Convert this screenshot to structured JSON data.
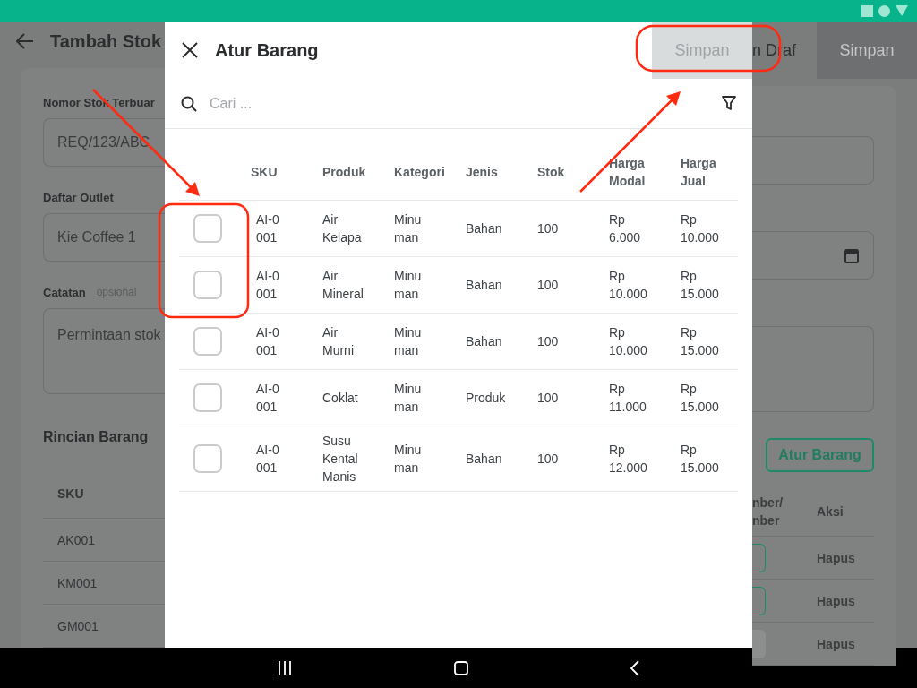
{
  "background_page": {
    "title": "Tambah Stok",
    "draft_button": "n Draf",
    "save_button": "Simpan",
    "fields": [
      {
        "label": "Nomor Stok Terbuar",
        "value": "REQ/123/ABC",
        "kind": "text"
      },
      {
        "label": "Daftar Outlet",
        "value": "Kie Coffee 1",
        "kind": "date"
      },
      {
        "label": "Catatan",
        "hint": "opsional",
        "value": "Permintaan stok",
        "kind": "textarea"
      }
    ],
    "section_title": "Rincian Barang",
    "manage_button": "Atur Barang",
    "table": {
      "columns": [
        "SKU",
        "nber/ nber",
        "Aksi"
      ],
      "rows": [
        {
          "sku": "AK001",
          "action": "Hapus",
          "disabled": false
        },
        {
          "sku": "KM001",
          "action": "Hapus",
          "disabled": false
        },
        {
          "sku": "GM001",
          "action": "Hapus",
          "disabled": true
        }
      ]
    }
  },
  "dialog": {
    "title": "Atur Barang",
    "save_button": {
      "label": "Simpan",
      "disabled": true
    },
    "search": {
      "placeholder": "Cari ..."
    },
    "table": {
      "columns": [
        "SKU",
        "Produk",
        "Kategori",
        "Jenis",
        "Stok",
        "Harga Modal",
        "Harga Jual"
      ],
      "rows": [
        {
          "checked": false,
          "cells": [
            "AI-0001",
            "Air Kelapa",
            "Minuman",
            "Bahan",
            "100",
            "Rp 6.000",
            "Rp 10.000"
          ]
        },
        {
          "checked": false,
          "cells": [
            "AI-0001",
            "Air Mineral",
            "Minuman",
            "Bahan",
            "100",
            "Rp 10.000",
            "Rp 15.000"
          ]
        },
        {
          "checked": false,
          "cells": [
            "AI-0001",
            "Air Murni",
            "Minuman",
            "Bahan",
            "100",
            "Rp 10.000",
            "Rp 15.000"
          ]
        },
        {
          "checked": false,
          "cells": [
            "AI-0001",
            "Coklat",
            "Minuman",
            "Produk",
            "100",
            "Rp 11.000",
            "Rp 15.000"
          ]
        },
        {
          "checked": false,
          "cells": [
            "AI-0001",
            "Susu Kental Manis",
            "Minuman",
            "Bahan",
            "100",
            "Rp 12.000",
            "Rp 15.000"
          ]
        }
      ]
    }
  }
}
